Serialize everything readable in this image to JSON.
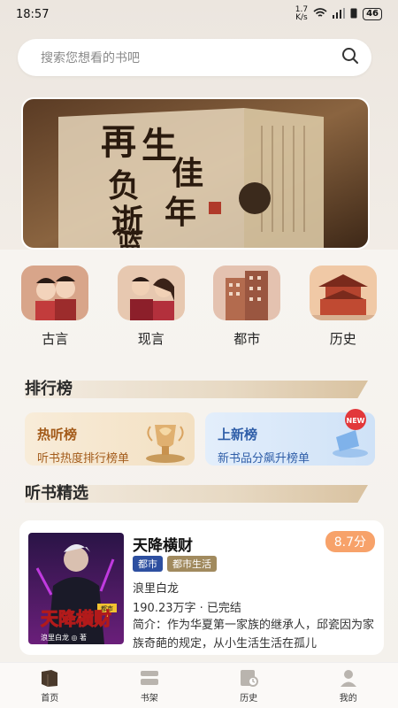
{
  "status": {
    "time": "18:57",
    "speed": "1.7\nK/s",
    "battery": "46"
  },
  "search": {
    "placeholder": "搜索您想看的书吧"
  },
  "banner": {
    "title_chars": [
      "再",
      "生",
      "负",
      "逝",
      "佳",
      "年",
      "篮"
    ]
  },
  "categories": [
    {
      "label": "古言",
      "icon": "ancient-romance-icon"
    },
    {
      "label": "现言",
      "icon": "modern-romance-icon"
    },
    {
      "label": "都市",
      "icon": "city-icon"
    },
    {
      "label": "历史",
      "icon": "history-icon"
    }
  ],
  "sections": {
    "ranking": "排行榜",
    "selected": "听书精选"
  },
  "rankings": [
    {
      "title": "热听榜",
      "subtitle": "听书热度排行榜单",
      "color": "#a35b1a"
    },
    {
      "title": "上新榜",
      "subtitle": "新书品分飙升榜单",
      "color": "#2f5ea8"
    }
  ],
  "book": {
    "title": "天降横财",
    "score": "8.7分",
    "tags": [
      "都市",
      "都市生活"
    ],
    "author": "浪里白龙",
    "meta": "190.23万字 · 已完结",
    "intro": "简介：作为华夏第一家族的继承人，邱瓷因为家族奇葩的规定，从小生活生活在孤儿",
    "cover_text": "天降横财",
    "cover_author": "浪里白龙 ◎ 著",
    "cover_badge": "都市"
  },
  "nav": [
    {
      "label": "首页",
      "icon": "book-home-icon",
      "active": true
    },
    {
      "label": "书架",
      "icon": "bookshelf-icon"
    },
    {
      "label": "历史",
      "icon": "history-book-icon"
    },
    {
      "label": "我的",
      "icon": "profile-icon"
    }
  ]
}
